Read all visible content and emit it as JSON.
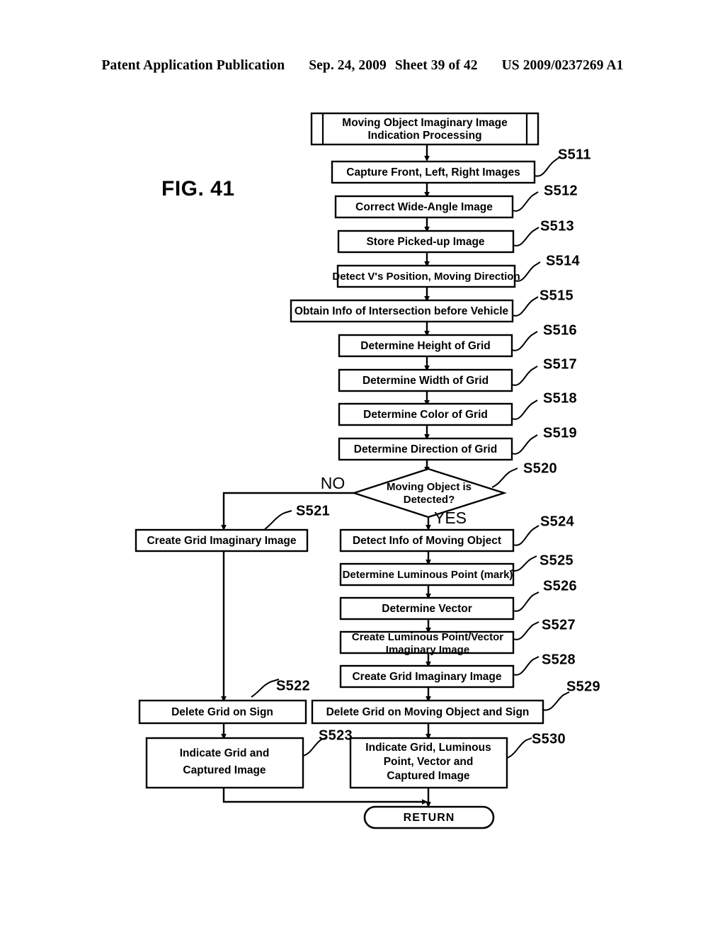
{
  "header": {
    "publication": "Patent Application Publication",
    "date": "Sep. 24, 2009",
    "sheet": "Sheet 39 of 42",
    "patent_number": "US 2009/0237269 A1"
  },
  "figure": {
    "label": "FIG. 41"
  },
  "flowchart": {
    "title_box": {
      "line1": "Moving Object Imaginary Image",
      "line2": "Indication Processing"
    },
    "terminator": {
      "label": "RETURN"
    },
    "branches": {
      "no": "NO",
      "yes": "YES"
    },
    "nodes": [
      {
        "id": "S511",
        "text": "Capture Front, Left, Right Images",
        "step": "S511"
      },
      {
        "id": "S512",
        "text": "Correct Wide-Angle Image",
        "step": "S512"
      },
      {
        "id": "S513",
        "text": "Store Picked-up Image",
        "step": "S513"
      },
      {
        "id": "S514",
        "text": "Detect V's Position, Moving Direction",
        "step": "S514"
      },
      {
        "id": "S515",
        "text": "Obtain Info of Intersection before Vehicle",
        "step": "S515"
      },
      {
        "id": "S516",
        "text": "Determine Height of Grid",
        "step": "S516"
      },
      {
        "id": "S517",
        "text": "Determine Width of Grid",
        "step": "S517"
      },
      {
        "id": "S518",
        "text": "Determine Color of Grid",
        "step": "S518"
      },
      {
        "id": "S519",
        "text": "Determine Direction of Grid",
        "step": "S519"
      },
      {
        "id": "S520",
        "text_line1": "Moving Object is",
        "text_line2": "Detected?",
        "step": "S520"
      },
      {
        "id": "S521",
        "text": "Create Grid Imaginary Image",
        "step": "S521"
      },
      {
        "id": "S522",
        "text": "Delete Grid on Sign",
        "step": "S522"
      },
      {
        "id": "S523",
        "text_line1": "Indicate Grid and",
        "text_line2": "Captured Image",
        "step": "S523"
      },
      {
        "id": "S524",
        "text": "Detect Info of Moving Object",
        "step": "S524"
      },
      {
        "id": "S525",
        "text": "Determine Luminous Point (mark)",
        "step": "S525"
      },
      {
        "id": "S526",
        "text": "Determine Vector",
        "step": "S526"
      },
      {
        "id": "S527",
        "text_line1": "Create Luminous Point/Vector",
        "text_line2": "Imaginary Image",
        "step": "S527"
      },
      {
        "id": "S528",
        "text": "Create Grid Imaginary Image",
        "step": "S528"
      },
      {
        "id": "S529",
        "text": "Delete Grid on Moving Object and Sign",
        "step": "S529"
      },
      {
        "id": "S530",
        "text_line1": "Indicate Grid, Luminous",
        "text_line2": "Point, Vector and",
        "text_line3": "Captured Image",
        "step": "S530"
      }
    ]
  },
  "colors": {
    "ink": "#000000",
    "paper": "#ffffff"
  }
}
